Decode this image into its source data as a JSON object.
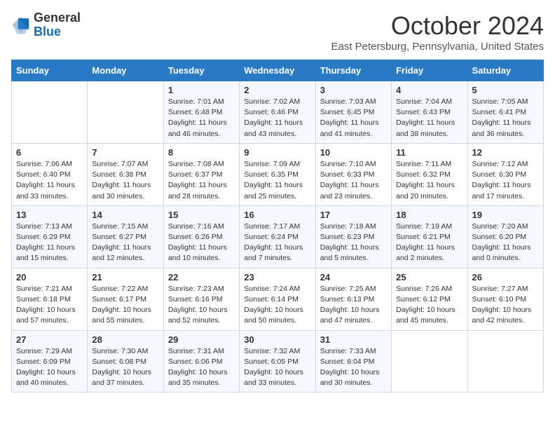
{
  "logo": {
    "general": "General",
    "blue": "Blue"
  },
  "header": {
    "month_title": "October 2024",
    "subtitle": "East Petersburg, Pennsylvania, United States"
  },
  "weekdays": [
    "Sunday",
    "Monday",
    "Tuesday",
    "Wednesday",
    "Thursday",
    "Friday",
    "Saturday"
  ],
  "weeks": [
    [
      {
        "day": "",
        "sunrise": "",
        "sunset": "",
        "daylight": ""
      },
      {
        "day": "",
        "sunrise": "",
        "sunset": "",
        "daylight": ""
      },
      {
        "day": "1",
        "sunrise": "Sunrise: 7:01 AM",
        "sunset": "Sunset: 6:48 PM",
        "daylight": "Daylight: 11 hours and 46 minutes."
      },
      {
        "day": "2",
        "sunrise": "Sunrise: 7:02 AM",
        "sunset": "Sunset: 6:46 PM",
        "daylight": "Daylight: 11 hours and 43 minutes."
      },
      {
        "day": "3",
        "sunrise": "Sunrise: 7:03 AM",
        "sunset": "Sunset: 6:45 PM",
        "daylight": "Daylight: 11 hours and 41 minutes."
      },
      {
        "day": "4",
        "sunrise": "Sunrise: 7:04 AM",
        "sunset": "Sunset: 6:43 PM",
        "daylight": "Daylight: 11 hours and 38 minutes."
      },
      {
        "day": "5",
        "sunrise": "Sunrise: 7:05 AM",
        "sunset": "Sunset: 6:41 PM",
        "daylight": "Daylight: 11 hours and 36 minutes."
      }
    ],
    [
      {
        "day": "6",
        "sunrise": "Sunrise: 7:06 AM",
        "sunset": "Sunset: 6:40 PM",
        "daylight": "Daylight: 11 hours and 33 minutes."
      },
      {
        "day": "7",
        "sunrise": "Sunrise: 7:07 AM",
        "sunset": "Sunset: 6:38 PM",
        "daylight": "Daylight: 11 hours and 30 minutes."
      },
      {
        "day": "8",
        "sunrise": "Sunrise: 7:08 AM",
        "sunset": "Sunset: 6:37 PM",
        "daylight": "Daylight: 11 hours and 28 minutes."
      },
      {
        "day": "9",
        "sunrise": "Sunrise: 7:09 AM",
        "sunset": "Sunset: 6:35 PM",
        "daylight": "Daylight: 11 hours and 25 minutes."
      },
      {
        "day": "10",
        "sunrise": "Sunrise: 7:10 AM",
        "sunset": "Sunset: 6:33 PM",
        "daylight": "Daylight: 11 hours and 23 minutes."
      },
      {
        "day": "11",
        "sunrise": "Sunrise: 7:11 AM",
        "sunset": "Sunset: 6:32 PM",
        "daylight": "Daylight: 11 hours and 20 minutes."
      },
      {
        "day": "12",
        "sunrise": "Sunrise: 7:12 AM",
        "sunset": "Sunset: 6:30 PM",
        "daylight": "Daylight: 11 hours and 17 minutes."
      }
    ],
    [
      {
        "day": "13",
        "sunrise": "Sunrise: 7:13 AM",
        "sunset": "Sunset: 6:29 PM",
        "daylight": "Daylight: 11 hours and 15 minutes."
      },
      {
        "day": "14",
        "sunrise": "Sunrise: 7:15 AM",
        "sunset": "Sunset: 6:27 PM",
        "daylight": "Daylight: 11 hours and 12 minutes."
      },
      {
        "day": "15",
        "sunrise": "Sunrise: 7:16 AM",
        "sunset": "Sunset: 6:26 PM",
        "daylight": "Daylight: 11 hours and 10 minutes."
      },
      {
        "day": "16",
        "sunrise": "Sunrise: 7:17 AM",
        "sunset": "Sunset: 6:24 PM",
        "daylight": "Daylight: 11 hours and 7 minutes."
      },
      {
        "day": "17",
        "sunrise": "Sunrise: 7:18 AM",
        "sunset": "Sunset: 6:23 PM",
        "daylight": "Daylight: 11 hours and 5 minutes."
      },
      {
        "day": "18",
        "sunrise": "Sunrise: 7:19 AM",
        "sunset": "Sunset: 6:21 PM",
        "daylight": "Daylight: 11 hours and 2 minutes."
      },
      {
        "day": "19",
        "sunrise": "Sunrise: 7:20 AM",
        "sunset": "Sunset: 6:20 PM",
        "daylight": "Daylight: 11 hours and 0 minutes."
      }
    ],
    [
      {
        "day": "20",
        "sunrise": "Sunrise: 7:21 AM",
        "sunset": "Sunset: 6:18 PM",
        "daylight": "Daylight: 10 hours and 57 minutes."
      },
      {
        "day": "21",
        "sunrise": "Sunrise: 7:22 AM",
        "sunset": "Sunset: 6:17 PM",
        "daylight": "Daylight: 10 hours and 55 minutes."
      },
      {
        "day": "22",
        "sunrise": "Sunrise: 7:23 AM",
        "sunset": "Sunset: 6:16 PM",
        "daylight": "Daylight: 10 hours and 52 minutes."
      },
      {
        "day": "23",
        "sunrise": "Sunrise: 7:24 AM",
        "sunset": "Sunset: 6:14 PM",
        "daylight": "Daylight: 10 hours and 50 minutes."
      },
      {
        "day": "24",
        "sunrise": "Sunrise: 7:25 AM",
        "sunset": "Sunset: 6:13 PM",
        "daylight": "Daylight: 10 hours and 47 minutes."
      },
      {
        "day": "25",
        "sunrise": "Sunrise: 7:26 AM",
        "sunset": "Sunset: 6:12 PM",
        "daylight": "Daylight: 10 hours and 45 minutes."
      },
      {
        "day": "26",
        "sunrise": "Sunrise: 7:27 AM",
        "sunset": "Sunset: 6:10 PM",
        "daylight": "Daylight: 10 hours and 42 minutes."
      }
    ],
    [
      {
        "day": "27",
        "sunrise": "Sunrise: 7:29 AM",
        "sunset": "Sunset: 6:09 PM",
        "daylight": "Daylight: 10 hours and 40 minutes."
      },
      {
        "day": "28",
        "sunrise": "Sunrise: 7:30 AM",
        "sunset": "Sunset: 6:08 PM",
        "daylight": "Daylight: 10 hours and 37 minutes."
      },
      {
        "day": "29",
        "sunrise": "Sunrise: 7:31 AM",
        "sunset": "Sunset: 6:06 PM",
        "daylight": "Daylight: 10 hours and 35 minutes."
      },
      {
        "day": "30",
        "sunrise": "Sunrise: 7:32 AM",
        "sunset": "Sunset: 6:05 PM",
        "daylight": "Daylight: 10 hours and 33 minutes."
      },
      {
        "day": "31",
        "sunrise": "Sunrise: 7:33 AM",
        "sunset": "Sunset: 6:04 PM",
        "daylight": "Daylight: 10 hours and 30 minutes."
      },
      {
        "day": "",
        "sunrise": "",
        "sunset": "",
        "daylight": ""
      },
      {
        "day": "",
        "sunrise": "",
        "sunset": "",
        "daylight": ""
      }
    ]
  ]
}
